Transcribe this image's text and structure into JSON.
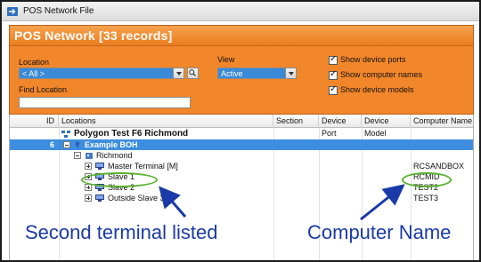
{
  "window": {
    "title": "POS Network File"
  },
  "header": {
    "title": "POS Network [33 records]"
  },
  "filters": {
    "location_label": "Location",
    "location_value": "< All >",
    "view_label": "View",
    "view_value": "Active",
    "find_label": "Find Location",
    "find_value": "",
    "options": [
      {
        "label": "Show device ports",
        "checked": true
      },
      {
        "label": "Show computer names",
        "checked": true
      },
      {
        "label": "Show device models",
        "checked": true
      }
    ]
  },
  "grid": {
    "columns": [
      "ID",
      "Locations",
      "Section",
      "Device Port",
      "Device Model",
      "Computer Name"
    ],
    "rows": [
      {
        "id": "",
        "location": "Polygon Test F6 Richmond",
        "computer": ""
      },
      {
        "id": "6",
        "location": "Example BOH",
        "computer": ""
      },
      {
        "id": "",
        "location": "Richmond",
        "computer": ""
      },
      {
        "id": "",
        "location": "Master Terminal [M]",
        "computer": "RCSANDBOX"
      },
      {
        "id": "",
        "location": "Slave 1",
        "computer": "RCMID"
      },
      {
        "id": "",
        "location": "Slave 2",
        "computer": "TEST2"
      },
      {
        "id": "",
        "location": "Outside Slave 3",
        "computer": "TEST3"
      }
    ]
  },
  "annotations": {
    "left": "Second terminal listed",
    "right": "Computer Name",
    "color": "#1a3aa8",
    "highlight_color": "#58b12c"
  },
  "colors": {
    "accent_orange": "#f2862a",
    "selection_blue": "#3d8ee0"
  }
}
